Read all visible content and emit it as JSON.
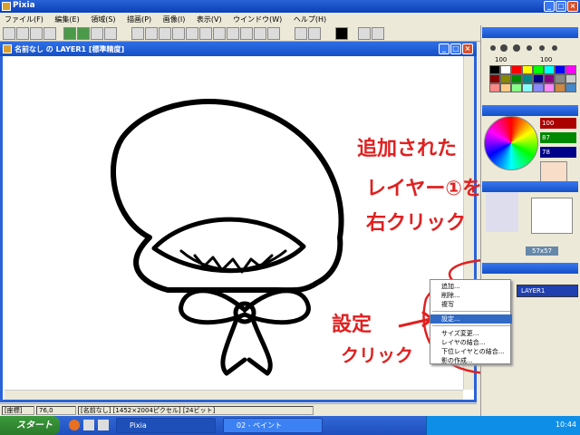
{
  "app": {
    "title": "Pixia"
  },
  "menu": [
    "ファイル(F)",
    "編集(E)",
    "領域(S)",
    "描画(P)",
    "画像(I)",
    "表示(V)",
    "ウインドウ(W)",
    "ヘルプ(H)"
  ],
  "document": {
    "title": "名前なし の LAYER1 [標準精度]"
  },
  "status": {
    "label": "[座標]",
    "value": "76,0",
    "info": "[名前なし] [1452×2004ピクセル] [24ビット]"
  },
  "panel": {
    "palette_label": "100",
    "palette_label2": "100",
    "rgb": [
      "100",
      "87",
      "78"
    ],
    "brush_size": "57x57",
    "layer_name": "LAYER1"
  },
  "context_menu": {
    "items": [
      "追加...",
      "削除...",
      "複写",
      "設定...",
      "サイズ変更...",
      "レイヤの結合...",
      "下位レイヤとの結合...",
      "影の作成..."
    ],
    "selected_index": 3
  },
  "annotations": {
    "line1": "追加された",
    "line2": "レイヤー①を",
    "line3": "右クリック",
    "settings1": "設定",
    "settings2": "クリック"
  },
  "taskbar": {
    "start": "スタート",
    "tasks": [
      "Pixia",
      "02 - ペイント"
    ],
    "clock": "10:44"
  },
  "colors": {
    "accent": "#2a63d8",
    "annotation": "#e02020",
    "selection": "#316ac5"
  }
}
